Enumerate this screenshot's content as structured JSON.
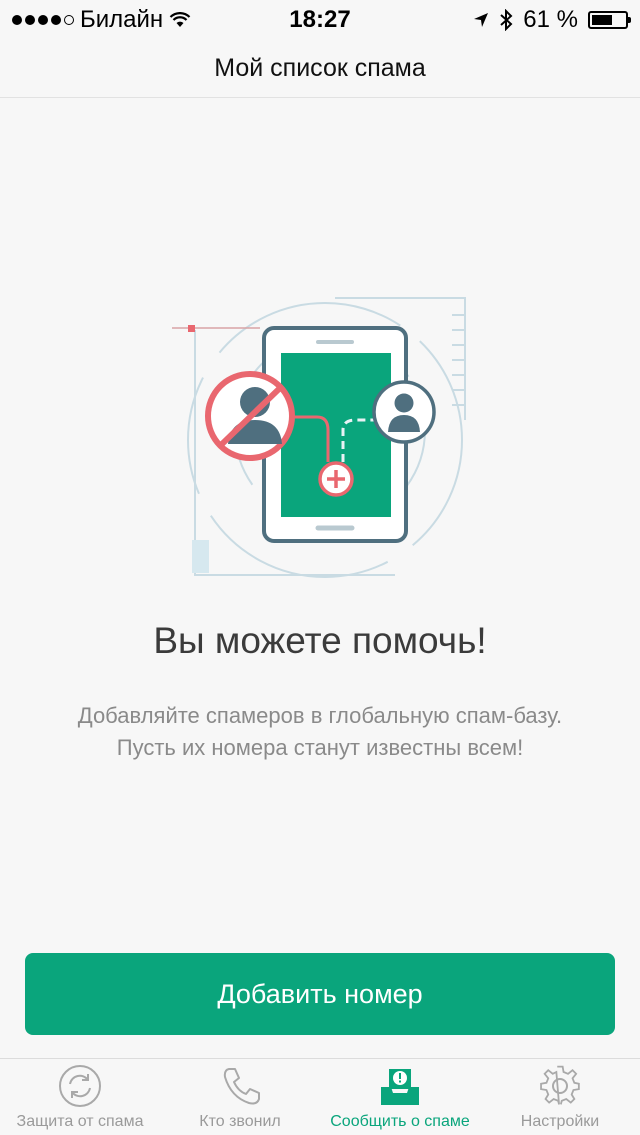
{
  "status_bar": {
    "carrier": "Билайн",
    "time": "18:27",
    "battery_percent": "61 %",
    "battery_level": 0.61,
    "signal_bars": 4
  },
  "nav": {
    "title": "Мой список спама"
  },
  "main": {
    "headline": "Вы можете помочь!",
    "description_line1": "Добавляйте спамеров в глобальную спам-базу.",
    "description_line2": "Пусть их номера станут известны всем!",
    "add_button_label": "Добавить номер"
  },
  "tabs": [
    {
      "label": "Защита от спама",
      "icon": "sync-icon",
      "active": false
    },
    {
      "label": "Кто звонил",
      "icon": "phone-icon",
      "active": false
    },
    {
      "label": "Сообщить о спаме",
      "icon": "report-inbox-icon",
      "active": true
    },
    {
      "label": "Настройки",
      "icon": "gear-icon",
      "active": false
    }
  ],
  "colors": {
    "accent": "#0aa57c",
    "phone_screen": "#0aa57c",
    "block_red": "#e9676f",
    "avatar_gray": "#4f6f7f"
  }
}
